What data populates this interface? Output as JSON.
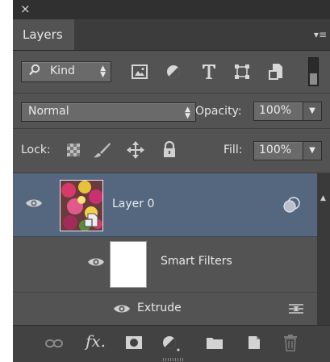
{
  "window": {
    "close_glyph": "×"
  },
  "tabs": [
    {
      "label": "Layers"
    }
  ],
  "panel_menu_glyph": "▾≡",
  "filter": {
    "kind_label": "Kind",
    "search_icon": "search-icon",
    "filter_icons": [
      "image-filter-icon",
      "adjustment-filter-icon",
      "type-filter-icon",
      "shape-filter-icon",
      "smart-object-filter-icon"
    ]
  },
  "blend": {
    "mode": "Normal",
    "opacity_label": "Opacity:",
    "opacity_value": "100%"
  },
  "lock": {
    "label": "Lock:",
    "fill_label": "Fill:",
    "fill_value": "100%"
  },
  "layers": [
    {
      "name": "Layer 0",
      "selected": true,
      "visible": true,
      "smart_object": true
    },
    {
      "name": "Smart Filters",
      "visible": true
    },
    {
      "name": "Extrude",
      "visible": true
    }
  ],
  "colors": {
    "panel_bg": "#535353",
    "selected_layer": "#55677f",
    "topbar": "#303030"
  }
}
